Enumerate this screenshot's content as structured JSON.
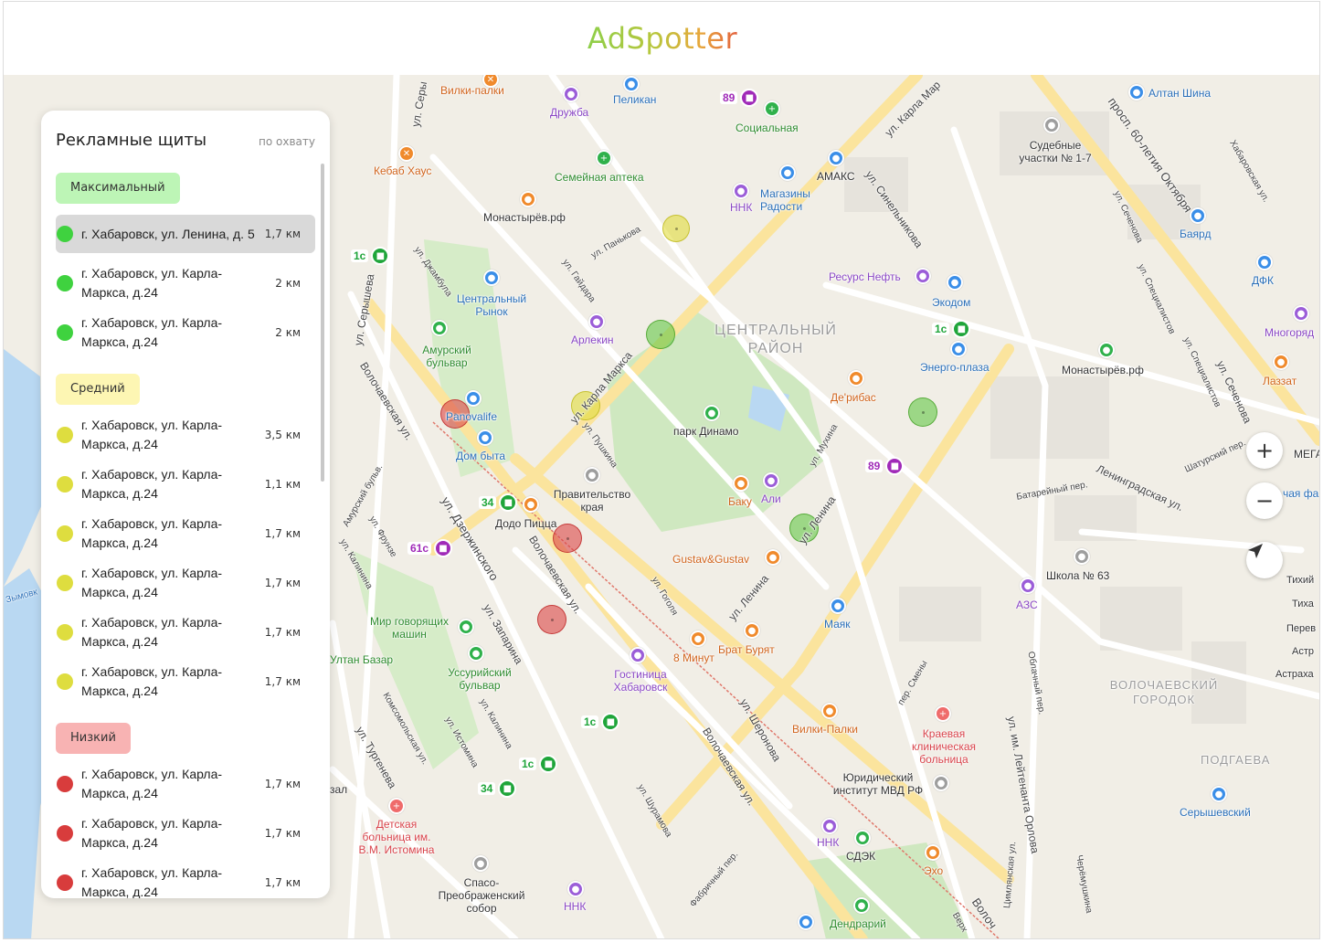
{
  "app": {
    "logo": "AdSpotter"
  },
  "panel": {
    "title": "Рекламные щиты",
    "sort_label": "по охвату",
    "groups": [
      {
        "label": "Максимальный",
        "items": [
          {
            "address": "г. Хабаровск, ул. Ленина, д. 5",
            "distance": "1,7 км",
            "selected": true
          },
          {
            "address": "г. Хабаровск, ул. Карла-Маркса, д.24",
            "distance": "2 км"
          },
          {
            "address": "г. Хабаровск, ул. Карла-Маркса, д.24",
            "distance": "2 км"
          }
        ]
      },
      {
        "label": "Средний",
        "items": [
          {
            "address": "г. Хабаровск, ул. Карла-Маркса, д.24",
            "distance": "3,5 км"
          },
          {
            "address": "г. Хабаровск, ул. Карла-Маркса, д.24",
            "distance": "1,1 км"
          },
          {
            "address": "г. Хабаровск, ул. Карла-Маркса, д.24",
            "distance": "1,7 км"
          },
          {
            "address": "г. Хабаровск, ул. Карла-Маркса, д.24",
            "distance": "1,7 км"
          },
          {
            "address": "г. Хабаровск, ул. Карла-Маркса, д.24",
            "distance": "1,7 км"
          },
          {
            "address": "г. Хабаровск, ул. Карла-Маркса, д.24",
            "distance": "1,7 км"
          }
        ]
      },
      {
        "label": "Низкий",
        "items": [
          {
            "address": "г. Хабаровск, ул. Карла-Маркса, д.24",
            "distance": "1,7 км"
          },
          {
            "address": "г. Хабаровск, ул. Карла-Маркса, д.24",
            "distance": "1,7 км"
          },
          {
            "address": "г. Хабаровск, ул. Карла-Маркса, д.24",
            "distance": "1,7 км"
          }
        ]
      }
    ]
  },
  "map": {
    "controls": {
      "zoom_in": "+",
      "zoom_out": "−"
    },
    "districts": {
      "central": "ЦЕНТРАЛЬНЫЙ РАЙОН",
      "volochaevsky": "ВОЛОЧАЕВСКИЙ ГОРОДОК",
      "podgaeva": "ПОДГАЕВА"
    },
    "places": {
      "vilki_palki_top": "Вилки-палки",
      "druzhba": "Дружба",
      "pelikan": "Пеликан",
      "socialnaya": "Социальная",
      "kebab": "Кебаб Хаус",
      "semeynaya": "Семейная аптека",
      "amaks": "АМАКС",
      "magaziny": "Магазины Радости",
      "nnk_top": "ННК",
      "monastyrev1": "Монастырёв.рф",
      "sud": "Судебные участки № 1-7",
      "altan": "Алтан Шина",
      "bayard": "Баярд",
      "dfk": "ДФК",
      "mnogoryad": "Многоряд",
      "lazzat": "Лаззат",
      "tsentr_rynok": "Центральный Рынок",
      "resurs": "Ресурс Нефть",
      "ekodom": "Экодом",
      "energo": "Энерго-плаза",
      "monastyrev2": "Монастырёв.рф",
      "arlekin": "Арлекин",
      "amursky": "Амурский бульвар",
      "panovalife": "Panovalife",
      "dom_byta": "Дом быта",
      "derybas": "Де'рибас",
      "park": "парк Динамо",
      "pravitelstvo": "Правительство края",
      "baku": "Баку",
      "ali": "Али",
      "dodo": "Додо Пицца",
      "gustav": "Gustav&Gustav",
      "shkola": "Школа № 63",
      "azs": "АЗС",
      "mir": "Мир говорящих машин",
      "ultan": "Ултан Базар",
      "mayak": "Маяк",
      "ussuri": "Уссурийский бульвар",
      "gostinica": "Гостиница Хабаровск",
      "8minut": "8 Минут",
      "brat": "Брат Бурят",
      "vilki_palki_bot": "Вилки-Палки",
      "kraevaya": "Краевая клиническая больница",
      "yurid": "Юридический институт МВД РФ",
      "detskaya": "Детская больница им. В.М. Истомина",
      "spaso": "Спасо-Преображенский собор",
      "nnk_bot": "ННК",
      "nnk_mid": "ННК",
      "sdek": "СДЭК",
      "eho": "Эхо",
      "dendrariy": "Дендрарий",
      "sery_store": "Серышевский",
      "mega": "МЕГА",
      "chaya": "чая фа",
      "zal": "зал",
      "tikhiy": "Тихий",
      "tikha": "Тиха",
      "pere": "Перев",
      "astr": "Астр",
      "astrakha": "Астраха",
      "zymovk": "Зымовк"
    },
    "streets": {
      "karla_marksa_top": "ул. Карла Мар",
      "karla_marksa_mid": "ул. Карла Маркса",
      "seryshev": "ул. Серышева",
      "seryshev2": "ул. Серы",
      "sinelnikova": "ул. Синельникова",
      "prosp60": "просп. 60-летия Октября",
      "dzhambula": "ул. Джамбула",
      "panykova": "ул. Панькова",
      "gaydara": "ул. Гайдара",
      "volochaev1": "Волочаевская ул.",
      "volochaev2": "Волочаевская ул.",
      "volochaev3": "Волочаевская ул.",
      "pushkina": "ул. Пушкина",
      "mukhina": "ул. Мухина",
      "lenina1": "ул. Ленина",
      "lenina2": "ул. Ленина",
      "dzerzhinskogo": "ул. Дзержинского",
      "zaparina": "ул. Запарина",
      "kalinina": "ул. Калинина",
      "kalinina2": "ул. Калинина",
      "gogolya": "ул. Гоголя",
      "sheronova": "ул. Шеронова",
      "leningradskaya": "Ленинградская ул.",
      "shatursky": "Шатурский пер.",
      "batareyny": "Батарейный пер.",
      "sechenova": "ул. Сеченова",
      "sechenova2": "ул. Сеченова",
      "specialistov": "ул. Специалистов",
      "specialistov2": "ул. Специалистов",
      "khabarovskaya": "Хабаровская ул.",
      "frunze": "ул. Фрунзе",
      "amursky_b": "Амурский бульв.",
      "komsomolskaya": "Комсомольская ул.",
      "turgeneva": "ул. Тургенева",
      "istomina": "ул. Истомина",
      "shuramova": "ул. Шурамова",
      "fabrichny": "Фабричный пер.",
      "leytenanta": "ул. им. Лейтенанта Орлова",
      "oblachny": "Облачный пер.",
      "tsimlyanskaya": "Цимлянская ул.",
      "smeny": "пер. Смены",
      "cheryomushkina": "Черёмушкина",
      "volo_bottom": "Волоч",
      "verkh": "Верх"
    },
    "buses": {
      "b89_top": "89",
      "b1c_left": "1с",
      "b1c_right": "1с",
      "b34_top": "34",
      "b61c": "61с",
      "b89_mid": "89",
      "b1c_mid": "1с",
      "b1c_low": "1с",
      "b34_low": "34"
    },
    "billboards": [
      {
        "level": "yellow"
      },
      {
        "level": "green"
      },
      {
        "level": "yellow"
      },
      {
        "level": "red"
      },
      {
        "level": "green"
      },
      {
        "level": "green"
      },
      {
        "level": "red"
      },
      {
        "level": "red"
      }
    ]
  }
}
